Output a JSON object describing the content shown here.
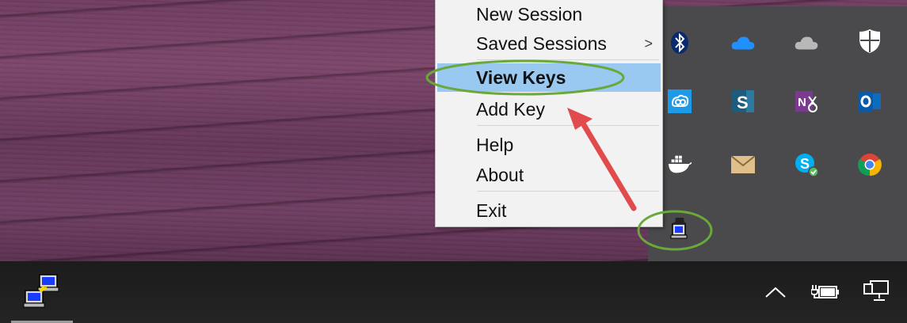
{
  "menu": {
    "items": [
      {
        "label": "New Session"
      },
      {
        "label": "Saved Sessions",
        "submenu_arrow": ">"
      },
      {
        "label": "View Keys",
        "selected": true
      },
      {
        "label": "Add Key"
      },
      {
        "label": "Help"
      },
      {
        "label": "About"
      },
      {
        "label": "Exit"
      }
    ]
  },
  "tray": {
    "icons": [
      "bluetooth-icon",
      "onedrive-icon",
      "onedrive-gray-icon",
      "windows-defender-icon",
      "sync-icon",
      "sway-icon",
      "onenote-clipper-icon",
      "outlook-icon",
      "docker-icon",
      "mail-icon",
      "skype-icon",
      "chrome-icon",
      "pageant-icon"
    ]
  },
  "taskbar": {
    "icons": [
      "putty-network-icon",
      "show-hidden-icons-chevron",
      "power-battery-icon",
      "network-icon"
    ]
  },
  "colors": {
    "selected_bg": "#99c8f0",
    "annotation_green": "#6aa83a",
    "annotation_arrow": "#e24b4b"
  }
}
